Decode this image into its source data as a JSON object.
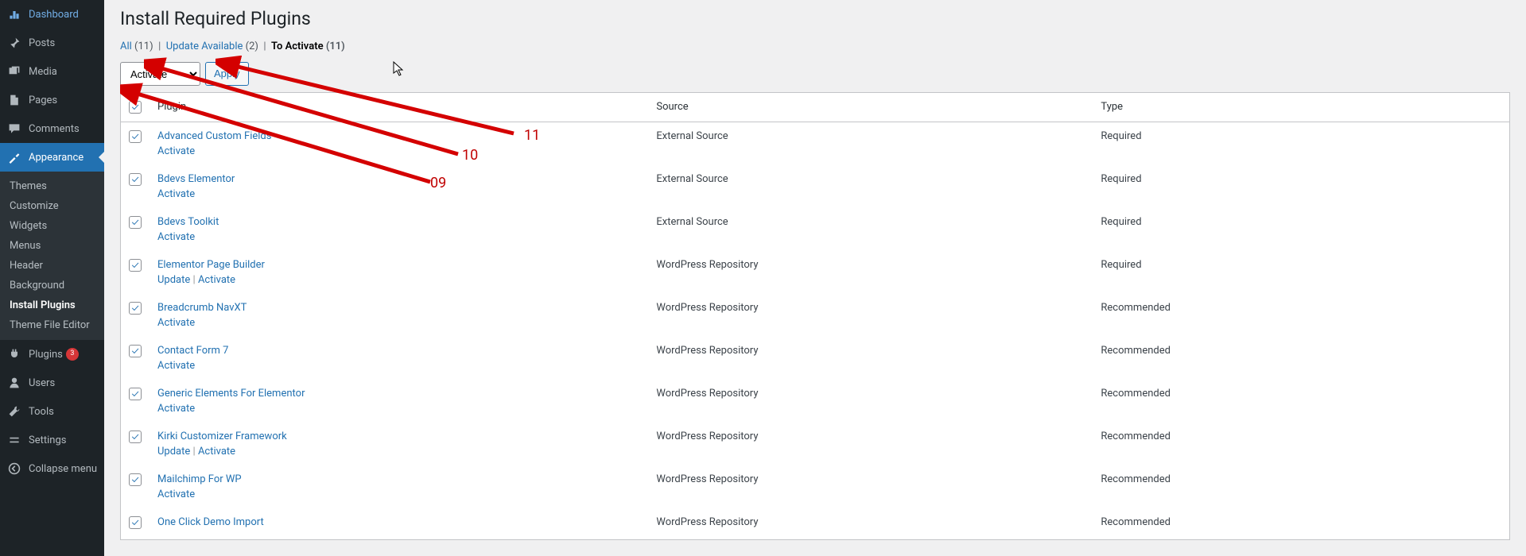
{
  "sidebar": {
    "items": [
      {
        "icon": "dashboard",
        "label": "Dashboard"
      },
      {
        "icon": "pin",
        "label": "Posts"
      },
      {
        "icon": "media",
        "label": "Media"
      },
      {
        "icon": "pages",
        "label": "Pages"
      },
      {
        "icon": "comments",
        "label": "Comments"
      },
      {
        "icon": "appearance",
        "label": "Appearance",
        "current": true
      },
      {
        "icon": "plugins",
        "label": "Plugins",
        "badge": "3"
      },
      {
        "icon": "users",
        "label": "Users"
      },
      {
        "icon": "tools",
        "label": "Tools"
      },
      {
        "icon": "settings",
        "label": "Settings"
      },
      {
        "icon": "collapse",
        "label": "Collapse menu"
      }
    ],
    "submenu": [
      "Themes",
      "Customize",
      "Widgets",
      "Menus",
      "Header",
      "Background",
      "Install Plugins",
      "Theme File Editor"
    ],
    "submenu_current": "Install Plugins"
  },
  "page": {
    "title": "Install Required Plugins",
    "filters": {
      "all_label": "All",
      "all_count": "(11)",
      "update_label": "Update Available",
      "update_count": "(2)",
      "toactivate_label": "To Activate",
      "toactivate_count": "(11)"
    },
    "bulk": {
      "select_value": "Activate",
      "apply_label": "Apply"
    },
    "columns": {
      "plugin": "Plugin",
      "source": "Source",
      "type": "Type"
    },
    "actions": {
      "activate": "Activate",
      "update": "Update"
    },
    "rows": [
      {
        "name": "Advanced Custom Fields",
        "source": "External Source",
        "type": "Required",
        "actions": [
          "activate"
        ]
      },
      {
        "name": "Bdevs Elementor",
        "source": "External Source",
        "type": "Required",
        "actions": [
          "activate"
        ]
      },
      {
        "name": "Bdevs Toolkit",
        "source": "External Source",
        "type": "Required",
        "actions": [
          "activate"
        ]
      },
      {
        "name": "Elementor Page Builder",
        "source": "WordPress Repository",
        "type": "Required",
        "actions": [
          "update",
          "activate"
        ]
      },
      {
        "name": "Breadcrumb NavXT",
        "source": "WordPress Repository",
        "type": "Recommended",
        "actions": [
          "activate"
        ]
      },
      {
        "name": "Contact Form 7",
        "source": "WordPress Repository",
        "type": "Recommended",
        "actions": [
          "activate"
        ]
      },
      {
        "name": "Generic Elements For Elementor",
        "source": "WordPress Repository",
        "type": "Recommended",
        "actions": [
          "activate"
        ]
      },
      {
        "name": "Kirki Customizer Framework",
        "source": "WordPress Repository",
        "type": "Recommended",
        "actions": [
          "update",
          "activate"
        ]
      },
      {
        "name": "Mailchimp For WP",
        "source": "WordPress Repository",
        "type": "Recommended",
        "actions": [
          "activate"
        ]
      },
      {
        "name": "One Click Demo Import",
        "source": "WordPress Repository",
        "type": "Recommended",
        "actions": []
      }
    ]
  },
  "annotations": {
    "a09": "09",
    "a10": "10",
    "a11": "11"
  }
}
